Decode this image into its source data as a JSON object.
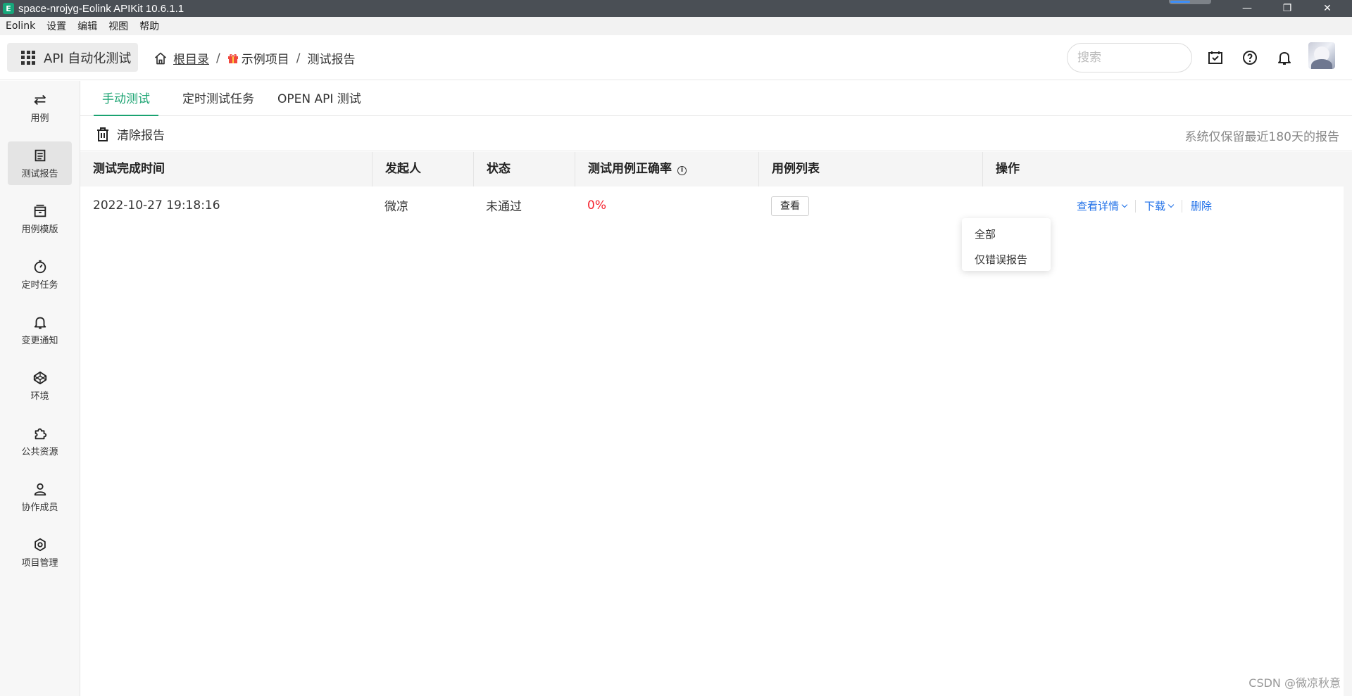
{
  "window": {
    "title": "space-nrojyg-Eolink APIKit 10.6.1.1",
    "controls": [
      "—",
      "❐",
      "✕"
    ]
  },
  "menubar": [
    "Eolink",
    "设置",
    "编辑",
    "视图",
    "帮助"
  ],
  "header": {
    "product": "API 自动化测试",
    "breadcrumb": {
      "root": "根目录",
      "sep": "/",
      "project": "示例项目",
      "current": "测试报告"
    },
    "search_placeholder": "搜索"
  },
  "sidebar": {
    "items": [
      {
        "label": "用例",
        "icon": "swap-arrows-icon"
      },
      {
        "label": "测试报告",
        "icon": "report-icon"
      },
      {
        "label": "用例模版",
        "icon": "template-icon"
      },
      {
        "label": "定时任务",
        "icon": "timer-icon"
      },
      {
        "label": "变更通知",
        "icon": "bell-icon"
      },
      {
        "label": "环境",
        "icon": "environment-icon"
      },
      {
        "label": "公共资源",
        "icon": "puzzle-icon"
      },
      {
        "label": "协作成员",
        "icon": "user-icon"
      },
      {
        "label": "项目管理",
        "icon": "settings-icon"
      }
    ],
    "active_index": 1
  },
  "tabs": [
    {
      "label": "手动测试",
      "active": true
    },
    {
      "label": "定时测试任务",
      "active": false
    },
    {
      "label": "OPEN API 测试",
      "active": false
    }
  ],
  "toolbar": {
    "clear_label": "清除报告",
    "notice": "系统仅保留最近180天的报告"
  },
  "table": {
    "columns": [
      "测试完成时间",
      "发起人",
      "状态",
      "测试用例正确率",
      "用例列表",
      "操作"
    ],
    "rows": [
      {
        "time": "2022-10-27 19:18:16",
        "initiator": "微凉",
        "status": "未通过",
        "rate": "0%",
        "case_list_btn": "查看",
        "actions": {
          "detail": "查看详情",
          "download": "下载",
          "delete": "删除"
        }
      }
    ]
  },
  "dropdown": {
    "items": [
      "全部",
      "仅错误报告"
    ]
  },
  "watermark": "CSDN @微凉秋意",
  "colors": {
    "accent": "#1aa371",
    "link": "#1e6fe8",
    "error": "#f5222d"
  }
}
